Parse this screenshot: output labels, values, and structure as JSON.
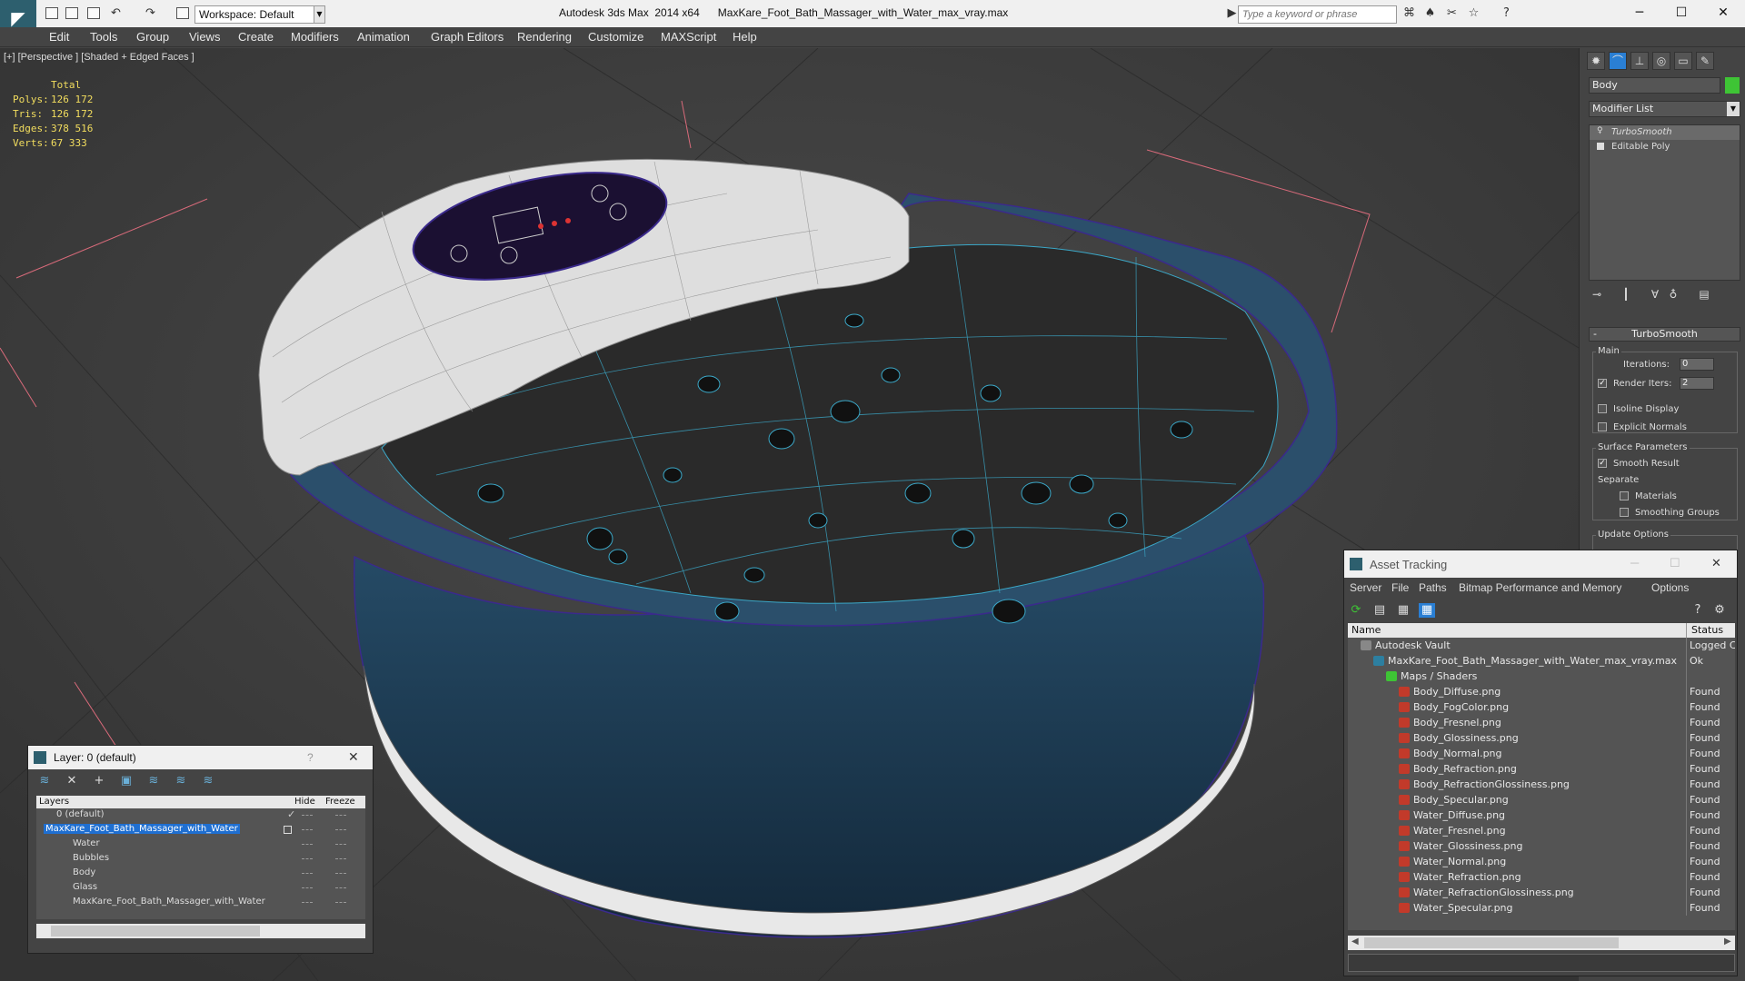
{
  "app": {
    "title": "Autodesk 3ds Max  2014 x64      MaxKare_Foot_Bath_Massager_with_Water_max_vray.max",
    "workspace": "Workspace: Default",
    "search_placeholder": "Type a keyword or phrase"
  },
  "menu": [
    "Edit",
    "Tools",
    "Group",
    "Views",
    "Create",
    "Modifiers",
    "Animation",
    "Graph Editors",
    "Rendering",
    "Customize",
    "MAXScript",
    "Help"
  ],
  "viewport": {
    "label": "[+] [Perspective ] [Shaded + Edged Faces ]",
    "stats": {
      "header": "Total",
      "rows": [
        {
          "key": "Polys:",
          "value": "126 172"
        },
        {
          "key": "Tris:",
          "value": "126 172"
        },
        {
          "key": "Edges:",
          "value": "378 516"
        },
        {
          "key": "Verts:",
          "value": "67 333"
        }
      ]
    }
  },
  "layer_dialog": {
    "title": "Layer: 0 (default)",
    "help": "?",
    "columns": [
      "Layers",
      "Hide",
      "Freeze"
    ],
    "rows": [
      {
        "name": "0 (default)",
        "indent": 1,
        "selected": false
      },
      {
        "name": "MaxKare_Foot_Bath_Massager_with_Water",
        "indent": 0,
        "selected": true
      },
      {
        "name": "Water",
        "indent": 2,
        "selected": false
      },
      {
        "name": "Bubbles",
        "indent": 2,
        "selected": false
      },
      {
        "name": "Body",
        "indent": 2,
        "selected": false
      },
      {
        "name": "Glass",
        "indent": 2,
        "selected": false
      },
      {
        "name": "MaxKare_Foot_Bath_Massager_with_Water",
        "indent": 2,
        "selected": false
      }
    ]
  },
  "command_panel": {
    "object_name": "Body",
    "object_color": "#3ec435",
    "modifier_list": "Modifier List",
    "stack": [
      "TurboSmooth",
      "Editable Poly"
    ],
    "rollout": "TurboSmooth",
    "main_label": "Main",
    "iterations_label": "Iterations:",
    "iterations_value": "0",
    "render_iters_label": "Render Iters:",
    "render_iters_value": "2",
    "isoline_label": "Isoline Display",
    "explicit_normals_label": "Explicit Normals",
    "surface_params_label": "Surface Parameters",
    "smooth_result_label": "Smooth Result",
    "separate_label": "Separate",
    "materials_label": "Materials",
    "smoothing_groups_label": "Smoothing Groups",
    "update_options_label": "Update Options"
  },
  "asset_tracking": {
    "title": "Asset Tracking",
    "menu": [
      "Server",
      "File",
      "Paths",
      "Bitmap Performance and Memory",
      "Options"
    ],
    "columns": [
      "Name",
      "Status"
    ],
    "rows": [
      {
        "name": "Autodesk Vault",
        "status": "Logged C",
        "indent": 0,
        "type": "vault"
      },
      {
        "name": "MaxKare_Foot_Bath_Massager_with_Water_max_vray.max",
        "status": "Ok",
        "indent": 1,
        "type": "max"
      },
      {
        "name": "Maps / Shaders",
        "status": "",
        "indent": 2,
        "type": "folder"
      },
      {
        "name": "Body_Diffuse.png",
        "status": "Found",
        "indent": 3,
        "type": "file"
      },
      {
        "name": "Body_FogColor.png",
        "status": "Found",
        "indent": 3,
        "type": "file"
      },
      {
        "name": "Body_Fresnel.png",
        "status": "Found",
        "indent": 3,
        "type": "file"
      },
      {
        "name": "Body_Glossiness.png",
        "status": "Found",
        "indent": 3,
        "type": "file"
      },
      {
        "name": "Body_Normal.png",
        "status": "Found",
        "indent": 3,
        "type": "file"
      },
      {
        "name": "Body_Refraction.png",
        "status": "Found",
        "indent": 3,
        "type": "file"
      },
      {
        "name": "Body_RefractionGlossiness.png",
        "status": "Found",
        "indent": 3,
        "type": "file"
      },
      {
        "name": "Body_Specular.png",
        "status": "Found",
        "indent": 3,
        "type": "file"
      },
      {
        "name": "Water_Diffuse.png",
        "status": "Found",
        "indent": 3,
        "type": "file"
      },
      {
        "name": "Water_Fresnel.png",
        "status": "Found",
        "indent": 3,
        "type": "file"
      },
      {
        "name": "Water_Glossiness.png",
        "status": "Found",
        "indent": 3,
        "type": "file"
      },
      {
        "name": "Water_Normal.png",
        "status": "Found",
        "indent": 3,
        "type": "file"
      },
      {
        "name": "Water_Refraction.png",
        "status": "Found",
        "indent": 3,
        "type": "file"
      },
      {
        "name": "Water_RefractionGlossiness.png",
        "status": "Found",
        "indent": 3,
        "type": "file"
      },
      {
        "name": "Water_Specular.png",
        "status": "Found",
        "indent": 3,
        "type": "file"
      }
    ]
  }
}
